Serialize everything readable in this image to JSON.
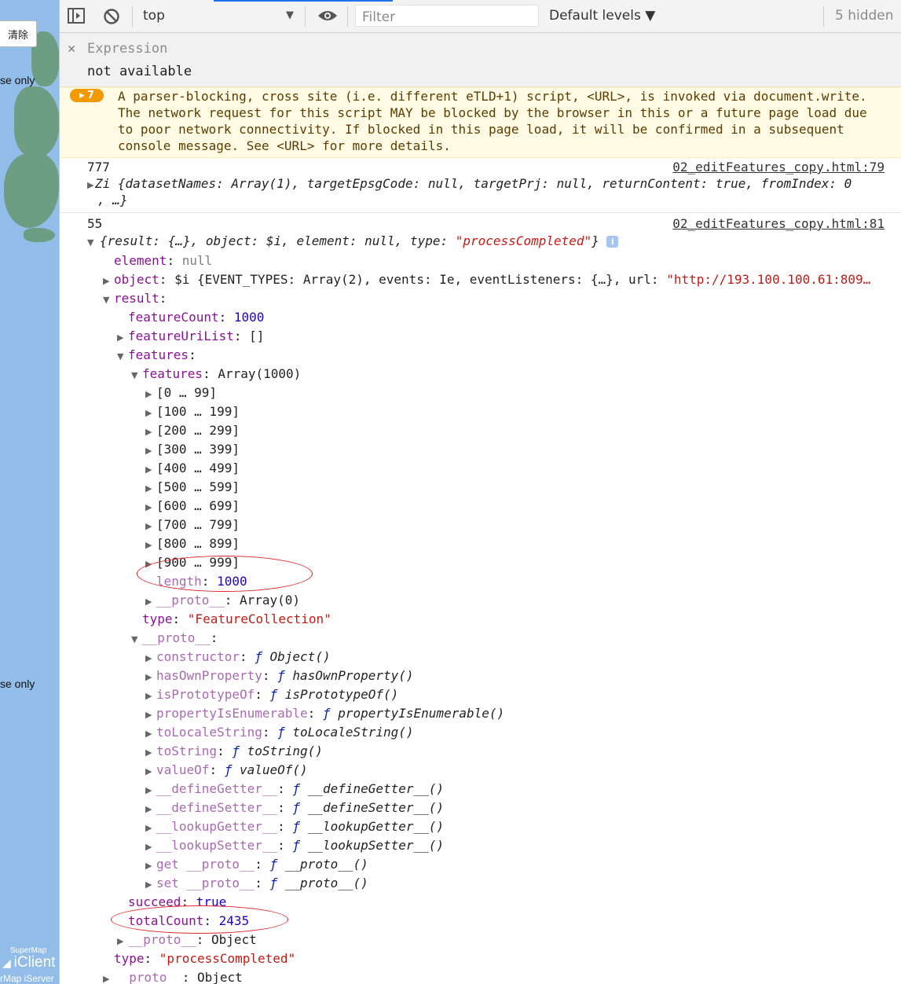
{
  "map": {
    "clear_button": "清除",
    "use_only_1": "se only",
    "use_only_2": "se only",
    "logo_small": "SuperMap",
    "logo_big": "iClient",
    "logo_iserver": "rMap iServer"
  },
  "toolbar": {
    "context": "top",
    "filter_placeholder": "Filter",
    "levels": "Default levels ▼",
    "hidden": "5 hidden"
  },
  "expression": {
    "label": "Expression",
    "value": "not available"
  },
  "warning": {
    "count": "7",
    "lines": [
      "A parser-blocking, cross site (i.e. different eTLD+1) script, <URL>, is invoked via document.write.",
      "The network request for this script MAY be blocked by the browser in this or a future page load due",
      "to poor network connectivity. If blocked in this page load, it will be confirmed in a subsequent",
      "console message. See <URL> for more details."
    ]
  },
  "log1": {
    "value": "777",
    "source": "02_editFeatures_copy.html:79",
    "obj_line1": "Zi {datasetNames: Array(1), targetEpsgCode: null, targetPrj: null, returnContent: true, fromIndex: 0",
    "obj_line2": ", …}"
  },
  "log2": {
    "value": "55",
    "source": "02_editFeatures_copy.html:81",
    "summary_open": "{result: {…}, object: $i, element: null, type: ",
    "summary_type": "\"processCompleted\"",
    "summary_close": "}",
    "element_key": "element",
    "element_val": "null",
    "object_key": "object",
    "object_val": "$i {EVENT_TYPES: Array(2), events: Ie, eventListeners: {…}, url: ",
    "object_url": "\"http://193.100.100.61:809…",
    "result_key": "result",
    "featureCount_key": "featureCount",
    "featureCount_val": "1000",
    "featureUriList_key": "featureUriList",
    "featureUriList_val": "[]",
    "features_key": "features",
    "features_inner_key": "features",
    "features_inner_val": "Array(1000)",
    "ranges": [
      "[0 … 99]",
      "[100 … 199]",
      "[200 … 299]",
      "[300 … 399]",
      "[400 … 499]",
      "[500 … 599]",
      "[600 … 699]",
      "[700 … 799]",
      "[800 … 899]",
      "[900 … 999]"
    ],
    "length_key": "length",
    "length_val": "1000",
    "arr_proto_key": "__proto__",
    "arr_proto_val": "Array(0)",
    "type_key": "type",
    "type_val": "\"FeatureCollection\"",
    "obj_proto_key": "__proto__",
    "proto_members": [
      {
        "key": "constructor",
        "val": "Object()"
      },
      {
        "key": "hasOwnProperty",
        "val": "hasOwnProperty()"
      },
      {
        "key": "isPrototypeOf",
        "val": "isPrototypeOf()"
      },
      {
        "key": "propertyIsEnumerable",
        "val": "propertyIsEnumerable()"
      },
      {
        "key": "toLocaleString",
        "val": "toLocaleString()"
      },
      {
        "key": "toString",
        "val": "toString()"
      },
      {
        "key": "valueOf",
        "val": "valueOf()"
      },
      {
        "key": "__defineGetter__",
        "val": "__defineGetter__()"
      },
      {
        "key": "__defineSetter__",
        "val": "__defineSetter__()"
      },
      {
        "key": "__lookupGetter__",
        "val": "__lookupGetter__()"
      },
      {
        "key": "__lookupSetter__",
        "val": "__lookupSetter__()"
      },
      {
        "key": "get __proto__",
        "val": "__proto__()"
      },
      {
        "key": "set __proto__",
        "val": "__proto__()"
      }
    ],
    "fn_symbol": "ƒ",
    "succeed_key": "succeed",
    "succeed_val": "true",
    "totalCount_key": "totalCount",
    "totalCount_val": "2435",
    "result_proto_key": "__proto__",
    "result_proto_val": "Object",
    "outer_type_key": "type",
    "outer_type_val": "\"processCompleted\"",
    "outer_proto_key": "__proto__",
    "outer_proto_val": "Object"
  }
}
